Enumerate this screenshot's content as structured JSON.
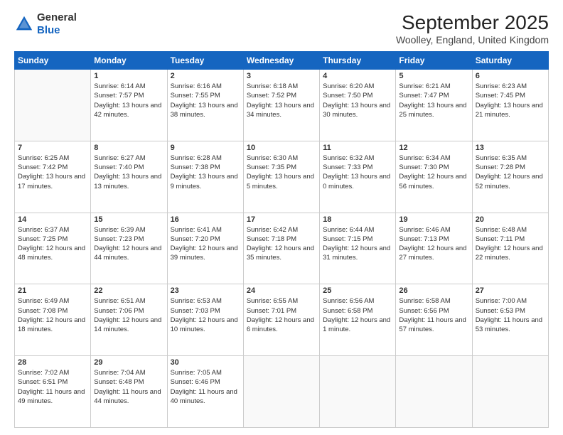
{
  "header": {
    "logo": {
      "line1": "General",
      "line2": "Blue"
    },
    "month": "September 2025",
    "location": "Woolley, England, United Kingdom"
  },
  "days_of_week": [
    "Sunday",
    "Monday",
    "Tuesday",
    "Wednesday",
    "Thursday",
    "Friday",
    "Saturday"
  ],
  "weeks": [
    [
      {
        "day": "",
        "empty": true
      },
      {
        "day": "1",
        "sunrise": "Sunrise: 6:14 AM",
        "sunset": "Sunset: 7:57 PM",
        "daylight": "Daylight: 13 hours and 42 minutes."
      },
      {
        "day": "2",
        "sunrise": "Sunrise: 6:16 AM",
        "sunset": "Sunset: 7:55 PM",
        "daylight": "Daylight: 13 hours and 38 minutes."
      },
      {
        "day": "3",
        "sunrise": "Sunrise: 6:18 AM",
        "sunset": "Sunset: 7:52 PM",
        "daylight": "Daylight: 13 hours and 34 minutes."
      },
      {
        "day": "4",
        "sunrise": "Sunrise: 6:20 AM",
        "sunset": "Sunset: 7:50 PM",
        "daylight": "Daylight: 13 hours and 30 minutes."
      },
      {
        "day": "5",
        "sunrise": "Sunrise: 6:21 AM",
        "sunset": "Sunset: 7:47 PM",
        "daylight": "Daylight: 13 hours and 25 minutes."
      },
      {
        "day": "6",
        "sunrise": "Sunrise: 6:23 AM",
        "sunset": "Sunset: 7:45 PM",
        "daylight": "Daylight: 13 hours and 21 minutes."
      }
    ],
    [
      {
        "day": "7",
        "sunrise": "Sunrise: 6:25 AM",
        "sunset": "Sunset: 7:42 PM",
        "daylight": "Daylight: 13 hours and 17 minutes."
      },
      {
        "day": "8",
        "sunrise": "Sunrise: 6:27 AM",
        "sunset": "Sunset: 7:40 PM",
        "daylight": "Daylight: 13 hours and 13 minutes."
      },
      {
        "day": "9",
        "sunrise": "Sunrise: 6:28 AM",
        "sunset": "Sunset: 7:38 PM",
        "daylight": "Daylight: 13 hours and 9 minutes."
      },
      {
        "day": "10",
        "sunrise": "Sunrise: 6:30 AM",
        "sunset": "Sunset: 7:35 PM",
        "daylight": "Daylight: 13 hours and 5 minutes."
      },
      {
        "day": "11",
        "sunrise": "Sunrise: 6:32 AM",
        "sunset": "Sunset: 7:33 PM",
        "daylight": "Daylight: 13 hours and 0 minutes."
      },
      {
        "day": "12",
        "sunrise": "Sunrise: 6:34 AM",
        "sunset": "Sunset: 7:30 PM",
        "daylight": "Daylight: 12 hours and 56 minutes."
      },
      {
        "day": "13",
        "sunrise": "Sunrise: 6:35 AM",
        "sunset": "Sunset: 7:28 PM",
        "daylight": "Daylight: 12 hours and 52 minutes."
      }
    ],
    [
      {
        "day": "14",
        "sunrise": "Sunrise: 6:37 AM",
        "sunset": "Sunset: 7:25 PM",
        "daylight": "Daylight: 12 hours and 48 minutes."
      },
      {
        "day": "15",
        "sunrise": "Sunrise: 6:39 AM",
        "sunset": "Sunset: 7:23 PM",
        "daylight": "Daylight: 12 hours and 44 minutes."
      },
      {
        "day": "16",
        "sunrise": "Sunrise: 6:41 AM",
        "sunset": "Sunset: 7:20 PM",
        "daylight": "Daylight: 12 hours and 39 minutes."
      },
      {
        "day": "17",
        "sunrise": "Sunrise: 6:42 AM",
        "sunset": "Sunset: 7:18 PM",
        "daylight": "Daylight: 12 hours and 35 minutes."
      },
      {
        "day": "18",
        "sunrise": "Sunrise: 6:44 AM",
        "sunset": "Sunset: 7:15 PM",
        "daylight": "Daylight: 12 hours and 31 minutes."
      },
      {
        "day": "19",
        "sunrise": "Sunrise: 6:46 AM",
        "sunset": "Sunset: 7:13 PM",
        "daylight": "Daylight: 12 hours and 27 minutes."
      },
      {
        "day": "20",
        "sunrise": "Sunrise: 6:48 AM",
        "sunset": "Sunset: 7:11 PM",
        "daylight": "Daylight: 12 hours and 22 minutes."
      }
    ],
    [
      {
        "day": "21",
        "sunrise": "Sunrise: 6:49 AM",
        "sunset": "Sunset: 7:08 PM",
        "daylight": "Daylight: 12 hours and 18 minutes."
      },
      {
        "day": "22",
        "sunrise": "Sunrise: 6:51 AM",
        "sunset": "Sunset: 7:06 PM",
        "daylight": "Daylight: 12 hours and 14 minutes."
      },
      {
        "day": "23",
        "sunrise": "Sunrise: 6:53 AM",
        "sunset": "Sunset: 7:03 PM",
        "daylight": "Daylight: 12 hours and 10 minutes."
      },
      {
        "day": "24",
        "sunrise": "Sunrise: 6:55 AM",
        "sunset": "Sunset: 7:01 PM",
        "daylight": "Daylight: 12 hours and 6 minutes."
      },
      {
        "day": "25",
        "sunrise": "Sunrise: 6:56 AM",
        "sunset": "Sunset: 6:58 PM",
        "daylight": "Daylight: 12 hours and 1 minute."
      },
      {
        "day": "26",
        "sunrise": "Sunrise: 6:58 AM",
        "sunset": "Sunset: 6:56 PM",
        "daylight": "Daylight: 11 hours and 57 minutes."
      },
      {
        "day": "27",
        "sunrise": "Sunrise: 7:00 AM",
        "sunset": "Sunset: 6:53 PM",
        "daylight": "Daylight: 11 hours and 53 minutes."
      }
    ],
    [
      {
        "day": "28",
        "sunrise": "Sunrise: 7:02 AM",
        "sunset": "Sunset: 6:51 PM",
        "daylight": "Daylight: 11 hours and 49 minutes."
      },
      {
        "day": "29",
        "sunrise": "Sunrise: 7:04 AM",
        "sunset": "Sunset: 6:48 PM",
        "daylight": "Daylight: 11 hours and 44 minutes."
      },
      {
        "day": "30",
        "sunrise": "Sunrise: 7:05 AM",
        "sunset": "Sunset: 6:46 PM",
        "daylight": "Daylight: 11 hours and 40 minutes."
      },
      {
        "day": "",
        "empty": true
      },
      {
        "day": "",
        "empty": true
      },
      {
        "day": "",
        "empty": true
      },
      {
        "day": "",
        "empty": true
      }
    ]
  ]
}
